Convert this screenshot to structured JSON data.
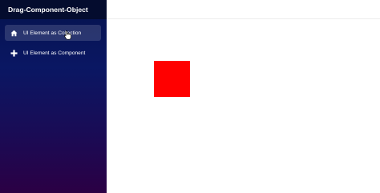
{
  "app": {
    "title": "Drag-Component-Object"
  },
  "sidebar": {
    "items": [
      {
        "label": "UI Element as Collection",
        "icon": "home-icon",
        "active": true
      },
      {
        "label": "UI Element as Component",
        "icon": "plus-icon",
        "active": false
      }
    ]
  },
  "main": {
    "draggable_box": {
      "color": "#ff0000"
    }
  },
  "colors": {
    "sidebar_top": "#05124d",
    "sidebar_bottom": "#2b0044",
    "header": "#040c2e",
    "box": "#ff0000"
  }
}
